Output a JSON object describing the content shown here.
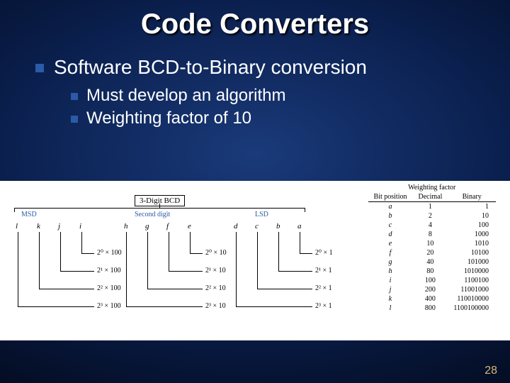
{
  "title": "Code Converters",
  "bullets": {
    "l1": "Software BCD-to-Binary conversion",
    "l2a": "Must develop an algorithm",
    "l2b": "Weighting factor of 10"
  },
  "figure": {
    "bcd_label": "3-Digit BCD",
    "digit_labels": {
      "msd": "MSD",
      "second": "Second digit",
      "lsd": "LSD"
    },
    "letters": [
      "l",
      "k",
      "j",
      "i",
      "h",
      "g",
      "f",
      "e",
      "d",
      "c",
      "b",
      "a"
    ],
    "group_labels": {
      "msd": [
        "2⁰ × 100",
        "2¹ × 100",
        "2² × 100",
        "2³ × 100"
      ],
      "second": [
        "2⁰ × 10",
        "2¹ × 10",
        "2² × 10",
        "2³ × 10"
      ],
      "lsd": [
        "2⁰ × 1",
        "2¹ × 1",
        "2² × 1",
        "2³ × 1"
      ]
    }
  },
  "weight_table": {
    "title": "Weighting factor",
    "headers": [
      "Bit position",
      "Decimal",
      "Binary"
    ],
    "rows": [
      {
        "bit": "a",
        "dec": "1",
        "bin": "1"
      },
      {
        "bit": "b",
        "dec": "2",
        "bin": "10"
      },
      {
        "bit": "c",
        "dec": "4",
        "bin": "100"
      },
      {
        "bit": "d",
        "dec": "8",
        "bin": "1000"
      },
      {
        "bit": "e",
        "dec": "10",
        "bin": "1010"
      },
      {
        "bit": "f",
        "dec": "20",
        "bin": "10100"
      },
      {
        "bit": "g",
        "dec": "40",
        "bin": "101000"
      },
      {
        "bit": "h",
        "dec": "80",
        "bin": "1010000"
      },
      {
        "bit": "i",
        "dec": "100",
        "bin": "1100100"
      },
      {
        "bit": "j",
        "dec": "200",
        "bin": "11001000"
      },
      {
        "bit": "k",
        "dec": "400",
        "bin": "110010000"
      },
      {
        "bit": "l",
        "dec": "800",
        "bin": "1100100000"
      }
    ]
  },
  "page_number": "28"
}
